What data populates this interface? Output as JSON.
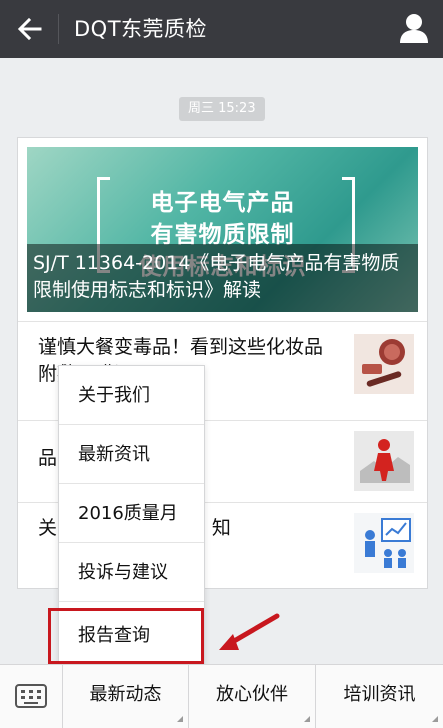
{
  "topbar": {
    "title": "DQT东莞质检"
  },
  "timestamp": "周三 15:23",
  "card": {
    "banner_lines": [
      "电子电气产品",
      "有害物质限制",
      "使用标志和标识"
    ],
    "banner_caption": "SJ/T 11364-2014《电子电气产品有害物质限制使用标志和标识》解读",
    "articles": [
      {
        "text": "谨慎大餐变毒品！看到这些化妆品 附敷面膜误区",
        "thumb": "cosmetics-thumbnail"
      },
      {
        "text": "品 误思维",
        "thumb": "red-figure-puzzle-thumbnail"
      },
      {
        "text": "关 及道路照明”标准 知",
        "thumb": "presentation-board-thumbnail"
      }
    ]
  },
  "menu": {
    "items": [
      "关于我们",
      "最新资讯",
      "2016质量月",
      "投诉与建议",
      "报告查询"
    ]
  },
  "bottombar": {
    "tabs": [
      "最新动态",
      "放心伙伴",
      "培训资讯"
    ]
  },
  "colors": {
    "topbar": "#393a3f",
    "highlight": "#c8171e",
    "background": "#eceef0"
  }
}
